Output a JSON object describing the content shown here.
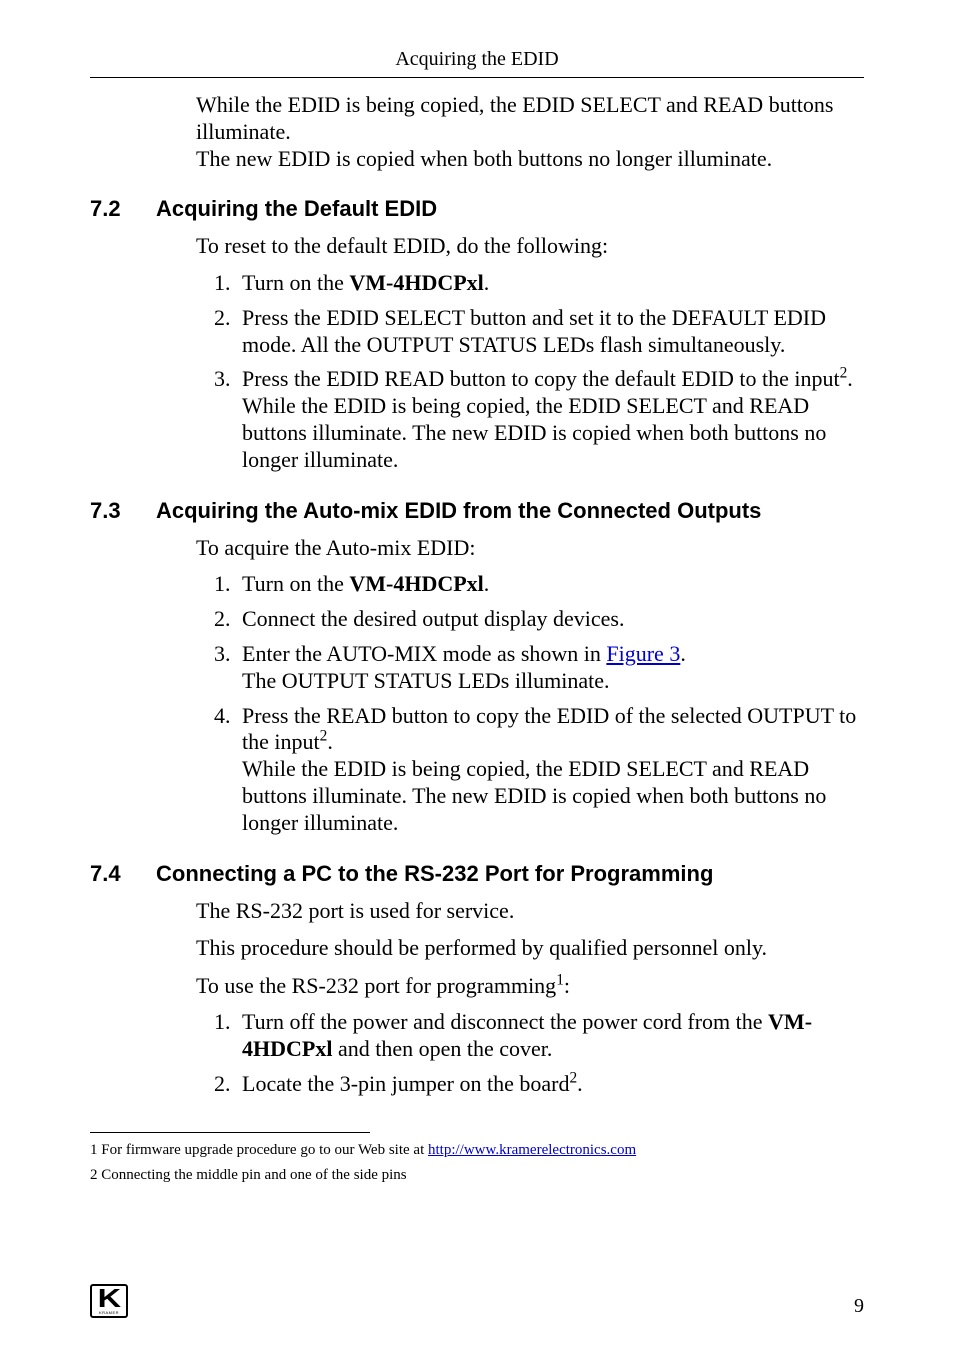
{
  "running_head": "Acquiring the EDID",
  "intro": {
    "line1": "While the EDID is being copied, the EDID SELECT and READ buttons illuminate.",
    "line2": "The new EDID is copied when both buttons no longer illuminate."
  },
  "sections": {
    "s72": {
      "num": "7.2",
      "title": "Acquiring the Default EDID"
    },
    "s73": {
      "num": "7.3",
      "title": "Acquiring the Auto-mix EDID from the Connected Outputs"
    },
    "s74": {
      "num": "7.4",
      "title": "Connecting a PC to the RS-232 Port for Programming"
    }
  },
  "s72_intro": "To reset to the default EDID, do the following:",
  "s72_steps": {
    "i1a": "Turn on the ",
    "i1b": "VM-4HDCPxl",
    "i1c": ".",
    "i2": "Press the EDID SELECT button and set it to the DEFAULT EDID mode. All the OUTPUT STATUS LEDs flash simultaneously.",
    "i3a": "Press the EDID READ button to copy the default EDID to the input",
    "i3sup": "2",
    "i3b": ". While the EDID is being copied, the EDID SELECT and READ buttons illuminate. The new EDID is copied when both buttons no longer illuminate."
  },
  "s73_intro": "To acquire the Auto-mix EDID:",
  "s73_steps": {
    "i1a": "Turn on the ",
    "i1b": "VM-4HDCPxl",
    "i1c": ".",
    "i2": "Connect the desired output display devices.",
    "i3a": "Enter the AUTO-MIX mode as shown in ",
    "i3link": "Figure 3",
    "i3b": ".",
    "i3c": "The OUTPUT STATUS LEDs illuminate.",
    "i4a": "Press the READ button to copy the EDID of the selected OUTPUT to the input",
    "i4sup": "2",
    "i4b": ".",
    "i4c": "While the EDID is being copied, the EDID SELECT and READ buttons illuminate.  The new EDID is copied when both buttons no longer illuminate."
  },
  "s74_p1": "The RS-232 port is used for service.",
  "s74_p2": "This procedure should be performed by qualified personnel only.",
  "s74_p3a": "To use the RS-232 port for programming",
  "s74_p3sup": "1",
  "s74_p3b": ":",
  "s74_steps": {
    "i1a": "Turn off the power and disconnect the power cord from the ",
    "i1b": "VM-4HDCPxl",
    "i1c": " and then open the cover.",
    "i2a": "Locate the 3-pin jumper on the board",
    "i2sup": "2",
    "i2b": "."
  },
  "footnotes": {
    "f1a": "1 For firmware upgrade procedure go to our Web site at ",
    "f1link": "http://www.kramerelectronics.com",
    "f2": "2 Connecting the middle pin and one of the side pins"
  },
  "logo": {
    "letter": "K",
    "brand": "KRAMER"
  },
  "page_number": "9"
}
